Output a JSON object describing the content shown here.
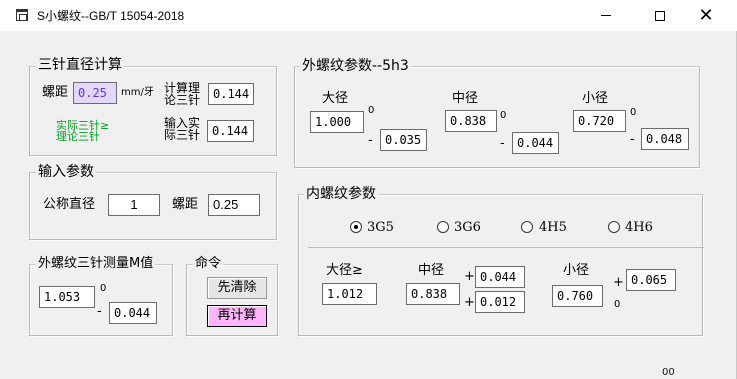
{
  "window": {
    "title": "S小螺纹--GB/T 15054-2018",
    "buttons": {
      "minimize": "—",
      "maximize": "□",
      "close": "✕"
    }
  },
  "three_pin": {
    "title": "三针直径计算",
    "pitch_label": "螺距",
    "pitch_value": "0.25",
    "pitch_unit": "mm/牙",
    "calc_label_1": "计算理",
    "calc_label_2": "论三针",
    "calc_value": "0.144",
    "compare_1": "实际三针≥",
    "compare_2": "理论三针",
    "actual_label_1": "输入实",
    "actual_label_2": "际三针",
    "actual_value": "0.144"
  },
  "inputs": {
    "title": "输入参数",
    "nominal_label": "公称直径",
    "nominal_value": "1",
    "pitch_label": "螺距",
    "pitch_value": "0.25"
  },
  "m_value": {
    "title": "外螺纹三针测量M值",
    "value": "1.053",
    "upper": "0",
    "minus": "-",
    "lower": "0.044"
  },
  "commands": {
    "title": "命令",
    "clear": "先清除",
    "recalc": "再计算"
  },
  "external": {
    "title": "外螺纹参数--5h3",
    "major": {
      "label": "大径",
      "value": "1.000",
      "upper": "0",
      "minus": "-",
      "lower": "0.035"
    },
    "pitch": {
      "label": "中径",
      "value": "0.838",
      "upper": "0",
      "minus": "-",
      "lower": "0.044"
    },
    "minor": {
      "label": "小径",
      "value": "0.720",
      "upper": "0",
      "minus": "-",
      "lower": "0.048"
    }
  },
  "internal": {
    "title": "内螺纹参数",
    "options": [
      "3G5",
      "3G6",
      "4H5",
      "4H6"
    ],
    "selected": "3G5",
    "major": {
      "label": "大径≥",
      "value": "1.012"
    },
    "pitch": {
      "label": "中径",
      "value": "0.838",
      "plus1": "+",
      "upper": "0.044",
      "plus2": "+",
      "lower": "0.012"
    },
    "minor": {
      "label": "小径",
      "value": "0.760",
      "plus": "+",
      "upper": "0.065",
      "lower": "0"
    }
  },
  "taskbar_fragment": "00"
}
